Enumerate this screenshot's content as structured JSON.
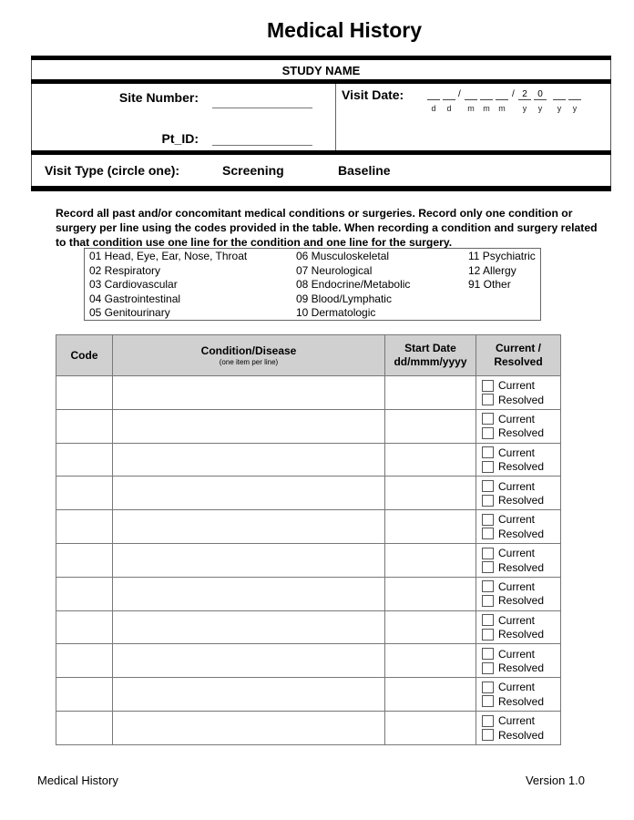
{
  "title": "Medical History",
  "header": {
    "study_name": "STUDY NAME",
    "site_number_label": "Site Number:",
    "pt_id_label": "Pt_ID:",
    "visit_date_label": "Visit Date:",
    "date_separator": "/",
    "date_prefill": [
      "",
      "",
      "",
      "",
      "",
      "2",
      "0",
      "",
      ""
    ],
    "date_hints": [
      "d",
      "d",
      "m",
      "m",
      "m",
      "y",
      "y",
      "y",
      "y"
    ],
    "visit_type_label": "Visit Type (circle one):",
    "visit_type_options": [
      "Screening",
      "Baseline"
    ]
  },
  "instructions": "Record all past and/or concomitant medical conditions or surgeries. Record only one condition or surgery per line using the codes provided in the table. When recording a condition and surgery related to that condition use one line for the condition and one line for the surgery.",
  "codes": {
    "column1": [
      "01 Head, Eye, Ear, Nose, Throat",
      "02 Respiratory",
      "03 Cardiovascular",
      "04 Gastrointestinal",
      "05 Genitourinary"
    ],
    "column2": [
      "06 Musculoskeletal",
      "07 Neurological",
      "08 Endocrine/Metabolic",
      "09 Blood/Lymphatic",
      "10 Dermatologic"
    ],
    "column3": [
      "11 Psychiatric",
      "12 Allergy",
      "91 Other"
    ]
  },
  "table": {
    "headers": {
      "code": "Code",
      "condition": "Condition/Disease",
      "condition_sub": "(one item per line)",
      "start_date": "Start Date",
      "start_date_format": "dd/mmm/yyyy",
      "status_line1": "Current /",
      "status_line2": "Resolved"
    },
    "status_options": [
      "Current",
      "Resolved"
    ],
    "row_count": 11
  },
  "footer": {
    "left": "Medical History",
    "right": "Version 1.0"
  }
}
